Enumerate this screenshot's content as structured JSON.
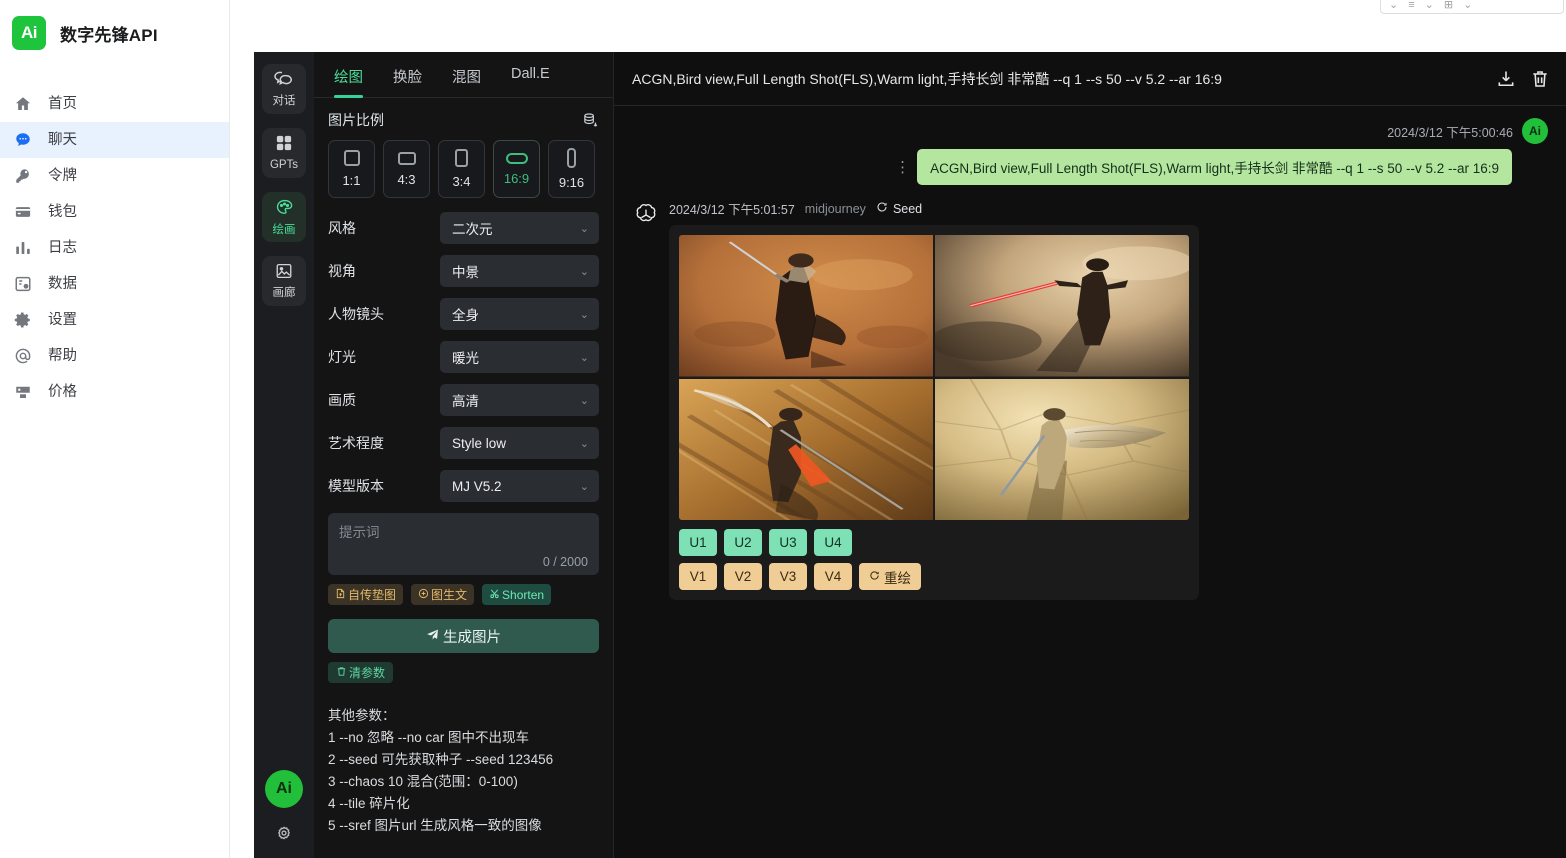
{
  "brand": {
    "logo_text": "Ai",
    "title": "数字先锋API"
  },
  "sidebar": {
    "items": [
      {
        "label": "首页",
        "icon": "home-icon",
        "active": false
      },
      {
        "label": "聊天",
        "icon": "chat-icon",
        "active": true
      },
      {
        "label": "令牌",
        "icon": "key-icon",
        "active": false
      },
      {
        "label": "钱包",
        "icon": "wallet-icon",
        "active": false
      },
      {
        "label": "日志",
        "icon": "chart-bar-icon",
        "active": false
      },
      {
        "label": "数据",
        "icon": "data-clock-icon",
        "active": false
      },
      {
        "label": "设置",
        "icon": "gear-icon",
        "active": false
      },
      {
        "label": "帮助",
        "icon": "at-sign-icon",
        "active": false
      },
      {
        "label": "价格",
        "icon": "price-tag-icon",
        "active": false
      }
    ]
  },
  "rail": {
    "items": [
      {
        "label": "对话",
        "icon": "speech-bubbles-icon",
        "active": false
      },
      {
        "label": "GPTs",
        "icon": "four-squares-icon",
        "active": false
      },
      {
        "label": "绘画",
        "icon": "palette-icon",
        "active": true
      },
      {
        "label": "画廊",
        "icon": "image-icon",
        "active": false
      }
    ],
    "avatar_text": "Ai",
    "settings_icon": "gear-icon"
  },
  "settings": {
    "tabs": [
      {
        "label": "绘图",
        "active": true
      },
      {
        "label": "换脸",
        "active": false
      },
      {
        "label": "混图",
        "active": false
      },
      {
        "label": "Dall.E",
        "active": false
      }
    ],
    "ratio_section": {
      "title": "图片比例",
      "preset_icon": "database-download-icon"
    },
    "ratios": [
      {
        "label": "1:1",
        "w": 16,
        "h": 16,
        "r": 3,
        "active": false
      },
      {
        "label": "4:3",
        "w": 18,
        "h": 13,
        "r": 3,
        "active": false
      },
      {
        "label": "3:4",
        "w": 13,
        "h": 18,
        "r": 3,
        "active": false
      },
      {
        "label": "16:9",
        "w": 22,
        "h": 11,
        "r": 6,
        "active": true
      },
      {
        "label": "9:16",
        "w": 9,
        "h": 20,
        "r": 4,
        "active": false
      }
    ],
    "fields": [
      {
        "label": "风格",
        "value": "二次元"
      },
      {
        "label": "视角",
        "value": "中景"
      },
      {
        "label": "人物镜头",
        "value": "全身"
      },
      {
        "label": "灯光",
        "value": "暖光"
      },
      {
        "label": "画质",
        "value": "高清"
      },
      {
        "label": "艺术程度",
        "value": "Style low"
      },
      {
        "label": "模型版本",
        "value": "MJ V5.2"
      }
    ],
    "prompt": {
      "placeholder": "提示词",
      "value": "",
      "counter": "0 / 2000"
    },
    "chips": [
      {
        "label": "自传垫图",
        "icon": "upload-image-icon",
        "tone": "tan"
      },
      {
        "label": "图生文",
        "icon": "image-to-text-icon",
        "tone": "tan"
      },
      {
        "label": "Shorten",
        "icon": "scissors-icon",
        "tone": "green"
      }
    ],
    "generate_button": {
      "label": "生成图片",
      "icon": "send-icon"
    },
    "clear_button": {
      "label": "清参数",
      "icon": "trash-icon"
    },
    "hints_title": "其他参数：",
    "hints": [
      "1 --no 忽略 --no car 图中不出现车",
      "2 --seed 可先获取种子 --seed 123456",
      "3 --chaos 10 混合(范围：0-100)",
      "4 --tile 碎片化",
      "5 --sref 图片url 生成风格一致的图像"
    ]
  },
  "chat": {
    "header": {
      "title": "ACGN,Bird view,Full Length Shot(FLS),Warm light,手持长剑 非常酷 --q 1 --s 50 --v 5.2 --ar 16:9",
      "download_icon": "download-icon",
      "delete_icon": "trash-icon"
    },
    "user_message": {
      "timestamp": "2024/3/12 下午5:00:46",
      "avatar_text": "Ai",
      "text": "ACGN,Bird view,Full Length Shot(FLS),Warm light,手持长剑 非常酷  --q 1 --s 50  --v 5.2 --ar 16:9",
      "menu_icon": "more-vertical-icon"
    },
    "bot_message": {
      "avatar_icon": "openai-logo-icon",
      "timestamp": "2024/3/12 下午5:01:57",
      "model": "midjourney",
      "seed_label": "Seed",
      "seed_icon": "refresh-icon",
      "upscale_buttons": [
        "U1",
        "U2",
        "U3",
        "U4"
      ],
      "variation_buttons": [
        "V1",
        "V2",
        "V3",
        "V4"
      ],
      "reroll_button": {
        "label": "重绘",
        "icon": "refresh-icon"
      }
    }
  },
  "colors": {
    "brand_green": "#1ec43c",
    "accent_green": "#36d399",
    "sidebar_active_bg": "#e8f1fe",
    "sidebar_active_fg": "#1b6ef3",
    "bubble_green": "#b5e6a0",
    "upscale_btn": "#7ee0b5",
    "variation_btn": "#f0cd94",
    "panel_bg": "#141414",
    "chat_bg": "#0f0f10"
  }
}
